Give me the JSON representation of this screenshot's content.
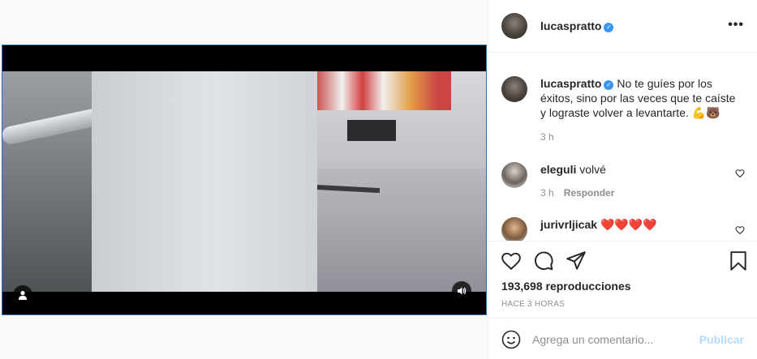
{
  "post": {
    "author": "lucaspratto",
    "caption": "No te guíes por los éxitos, sino por las veces que te caíste y lograste volver a levantarte. 💪🐻",
    "caption_time": "3 h",
    "views": "193,698 reproducciones",
    "posted_ago": "HACE 3 HORAS"
  },
  "comments": [
    {
      "user": "eleguli",
      "text": "volvé",
      "time": "3 h",
      "reply_label": "Responder"
    },
    {
      "user": "jurivrljicak",
      "text": "❤️❤️❤️❤️"
    }
  ],
  "add_comment": {
    "placeholder": "Agrega un comentario...",
    "publish_label": "Publicar"
  },
  "icons": {
    "more": "more-options-icon",
    "verified": "verified-badge-icon",
    "like": "heart-icon",
    "comment": "comment-icon",
    "share": "share-icon",
    "save": "bookmark-icon",
    "emoji": "emoji-icon",
    "user_tag": "user-tag-icon",
    "sound": "sound-icon"
  },
  "colors": {
    "verified": "#3897f0",
    "publish_disabled": "#b3dbff",
    "muted_text": "#8e8e8e"
  }
}
